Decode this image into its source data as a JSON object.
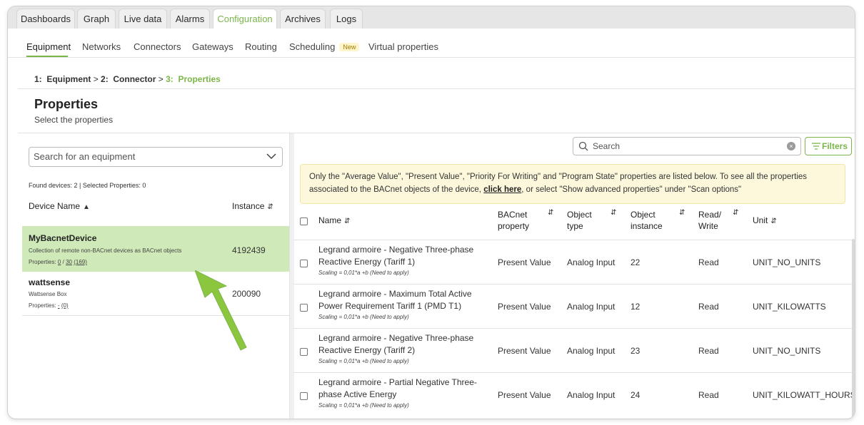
{
  "tabs": [
    {
      "label": "Dashboards",
      "active": false
    },
    {
      "label": "Graph",
      "active": false
    },
    {
      "label": "Live data",
      "active": false
    },
    {
      "label": "Alarms",
      "active": false
    },
    {
      "label": "Configuration",
      "active": true
    },
    {
      "label": "Archives",
      "active": false
    },
    {
      "label": "Logs",
      "active": false
    }
  ],
  "subnav": {
    "items": [
      "Equipment",
      "Networks",
      "Connectors",
      "Gateways",
      "Routing",
      "Scheduling",
      "Virtual properties"
    ],
    "new_badge": "New"
  },
  "breadcrumb": {
    "step1_num": "1:",
    "step1": "Equipment",
    "sep": ">",
    "step2_num": "2:",
    "step2": "Connector",
    "step3_num": "3:",
    "step3": "Properties"
  },
  "page": {
    "title": "Properties",
    "subtitle": "Select the properties"
  },
  "left": {
    "search_placeholder": "Search for an equipment",
    "found": "Found devices: 2 | Selected Properties: 0",
    "col_device": "Device Name",
    "col_instance": "Instance",
    "devices": [
      {
        "name": "MyBacnetDevice",
        "description": "Collection of remote non-BACnet devices as BACnet objects",
        "props_label": "Properties:",
        "props_sel": "0",
        "props_slash": "/",
        "props_total": "30",
        "props_all": "(169)",
        "instance": "4192439",
        "selected": true
      },
      {
        "name": "wattsense",
        "description": "Wattsense Box",
        "props_label": "Properties:",
        "props_sel": "-",
        "props_all": "(0)",
        "instance": "200090",
        "selected": false
      }
    ]
  },
  "right": {
    "search_placeholder": "Search",
    "filters_label": "Filters",
    "notice_part1": "Only the \"Average Value\", \"Present Value\", \"Priority For Writing\" and \"Program State\" properties are listed below. To see all the properties associated to the BACnet objects of the device,",
    "notice_link": "click here",
    "notice_part2": ", or select \"Show advanced properties\" under \"Scan options\"",
    "columns": {
      "name": "Name",
      "bacnet_property": "BACnet property",
      "object_type": "Object type",
      "object_instance": "Object instance",
      "read_write": "Read/ Write",
      "unit": "Unit"
    },
    "rows": [
      {
        "name": "Legrand armoire - Negative Three-phase Reactive Energy (Tariff 1)",
        "scaling": "Scaling = 0,01*a +b (Need to apply)",
        "property": "Present Value",
        "object_type": "Analog Input",
        "instance": "22",
        "rw": "Read",
        "unit": "UNIT_NO_UNITS"
      },
      {
        "name": "Legrand armoire - Maximum Total Active Power Requirement Tariff 1 (PMD T1)",
        "scaling": "Scaling = 0,01*a +b (Need to apply)",
        "property": "Present Value",
        "object_type": "Analog Input",
        "instance": "12",
        "rw": "Read",
        "unit": "UNIT_KILOWATTS"
      },
      {
        "name": "Legrand armoire - Negative Three-phase Reactive Energy (Tariff 2)",
        "scaling": "Scaling = 0,01*a +b (Need to apply)",
        "property": "Present Value",
        "object_type": "Analog Input",
        "instance": "23",
        "rw": "Read",
        "unit": "UNIT_NO_UNITS"
      },
      {
        "name": "Legrand armoire - Partial Negative Three-phase Active Energy",
        "scaling": "Scaling = 0,01*a +b (Need to apply)",
        "property": "Present Value",
        "object_type": "Analog Input",
        "instance": "24",
        "rw": "Read",
        "unit": "UNIT_KILOWATT_HOURS"
      }
    ]
  },
  "colors": {
    "accent": "#7ab648",
    "selected_row": "#cfeab8",
    "notice_bg": "#fdf8dc",
    "arrow": "#8cc63f"
  }
}
